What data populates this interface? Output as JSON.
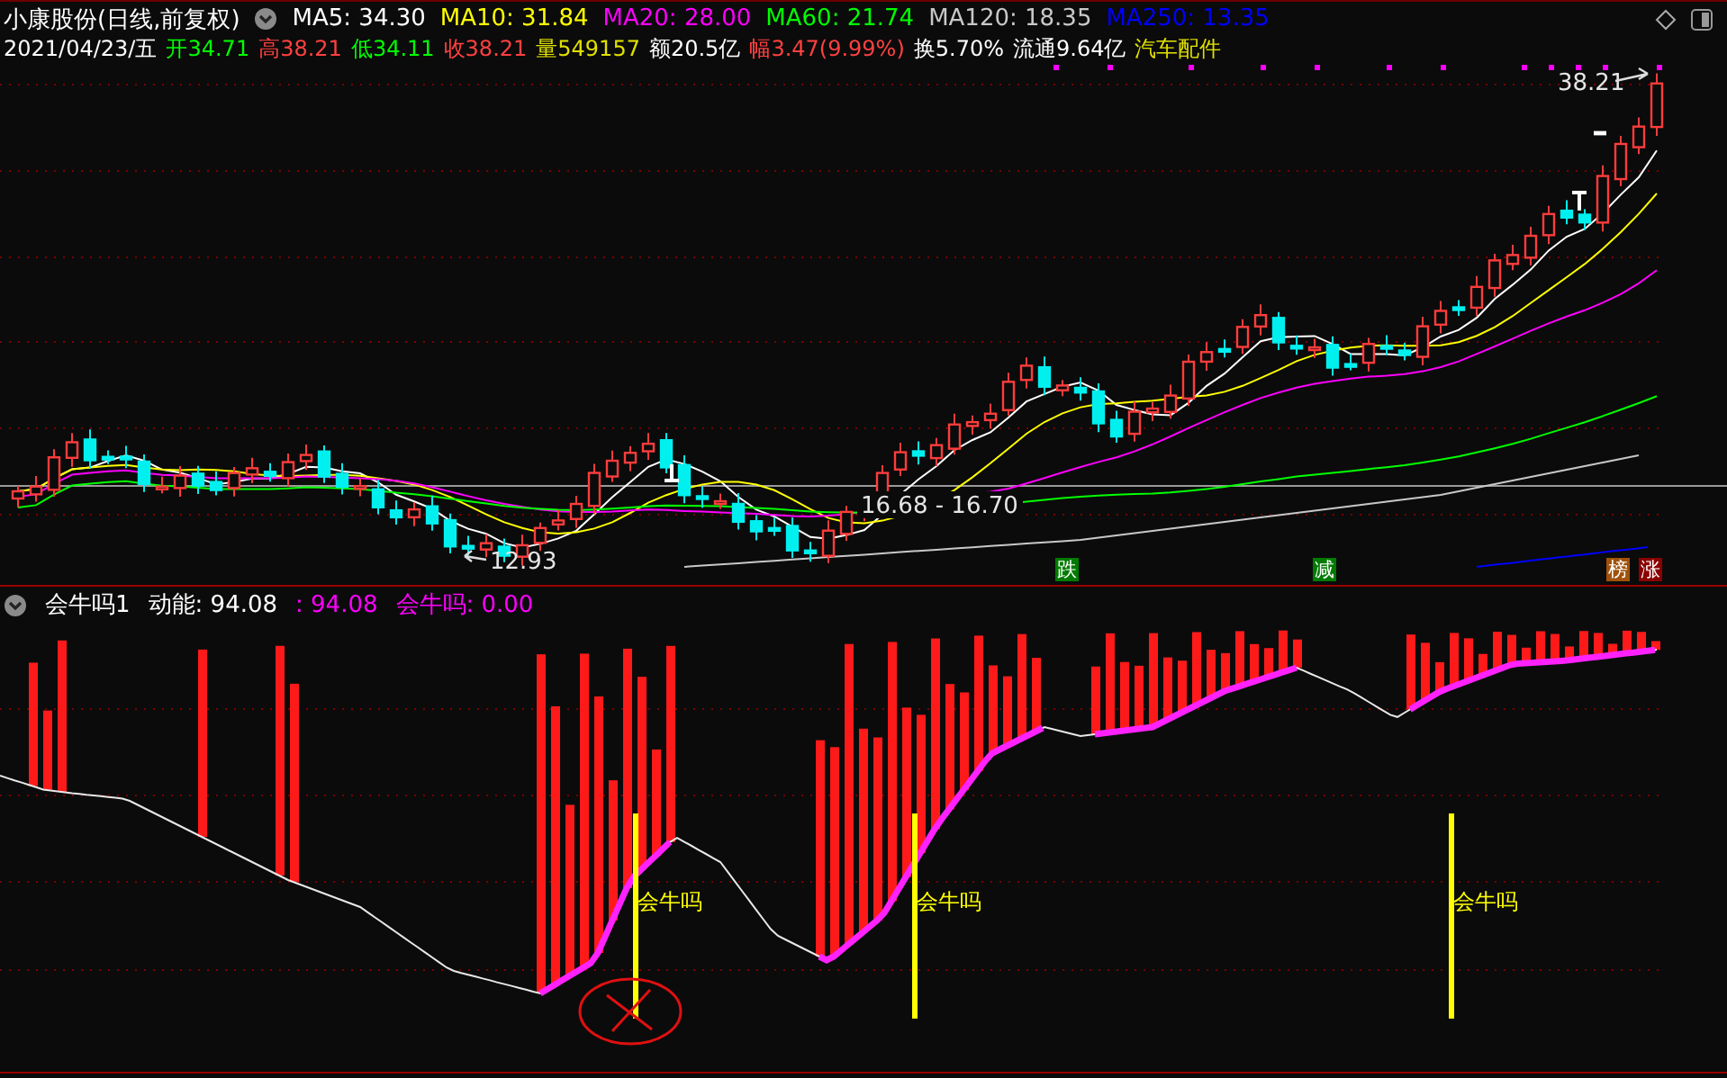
{
  "title_bar": {
    "stock": "小康股份(日线,前复权)",
    "indicators": [
      {
        "label": "MA5: 34.30",
        "color": "#ffffff"
      },
      {
        "label": "MA10: 31.84",
        "color": "#ffff00"
      },
      {
        "label": "MA20: 28.00",
        "color": "#ff00ff"
      },
      {
        "label": "MA60: 21.74",
        "color": "#00ff00"
      },
      {
        "label": "MA120: 18.35",
        "color": "#c8c8c8"
      },
      {
        "label": "MA250: 13.35",
        "color": "#0000ff"
      }
    ]
  },
  "quote_bar": {
    "date": "2021/04/23/五",
    "fields": [
      {
        "text": "开34.71",
        "color": "#00ff00"
      },
      {
        "text": "高38.21",
        "color": "#ff4040"
      },
      {
        "text": "低34.11",
        "color": "#00ff00"
      },
      {
        "text": "收38.21",
        "color": "#ff4040"
      },
      {
        "text": "量549157",
        "color": "#e0e000"
      },
      {
        "text": "额20.5亿",
        "color": "#ffffff"
      },
      {
        "text": "幅3.47(9.99%)",
        "color": "#ff4040"
      },
      {
        "text": "换5.70%",
        "color": "#ffffff"
      },
      {
        "text": "流通9.64亿",
        "color": "#ffffff"
      }
    ],
    "sector": "汽车配件"
  },
  "price_chart": {
    "low_label": "12.93",
    "range_label": "16.68 - 16.70",
    "high_label": "38.21",
    "markers": [
      {
        "text": "跌",
        "color": "#007a00"
      },
      {
        "text": "减",
        "color": "#007a00"
      },
      {
        "text": "榜",
        "color": "#a0520a"
      },
      {
        "text": "涨",
        "color": "#8b0000"
      }
    ]
  },
  "indicator_panel": {
    "name": "会牛吗1",
    "values": [
      {
        "text": "动能: 94.08",
        "color": "#ffffff"
      },
      {
        "text": ": 94.08",
        "color": "#ff00ff"
      },
      {
        "text": "会牛吗: 0.00",
        "color": "#ff00ff"
      }
    ],
    "signals": [
      {
        "label": "会牛吗"
      },
      {
        "label": "会牛吗"
      },
      {
        "label": "会牛吗"
      }
    ]
  }
}
